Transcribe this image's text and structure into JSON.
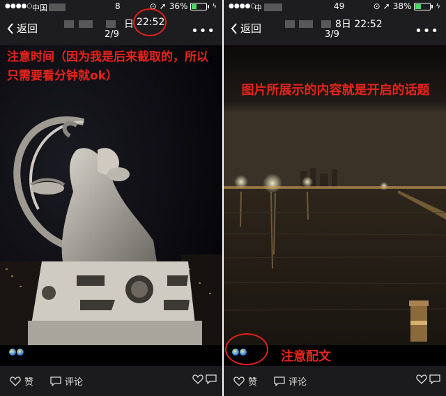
{
  "left": {
    "status": {
      "signal": "●●●●○",
      "carrier": "中国",
      "time_fragment": "8",
      "battery_percent": "36%",
      "battery_level": 0.36
    },
    "nav": {
      "back_label": "返回",
      "date_fragment": "日",
      "time": "22:52",
      "counter": "2/9",
      "more": "•••"
    },
    "annotation": "注意时间（因为我是后来截取的，所以只需要看分钟就ok）",
    "actions": {
      "like": "赞",
      "comment": "评论"
    }
  },
  "right": {
    "status": {
      "signal": "●●●●○",
      "carrier": "中",
      "time_fragment": "49",
      "battery_percent": "38%",
      "battery_level": 0.38
    },
    "nav": {
      "back_label": "返回",
      "date_time": "8日 22:52",
      "counter": "3/9",
      "more": "•••"
    },
    "annotation_top": "图片所展示的内容就是开启的话题",
    "annotation_bottom": "注意配文",
    "actions": {
      "like": "赞",
      "comment": "评论"
    }
  },
  "colors": {
    "annotation": "#e8231c",
    "bar": "#1d1d1f",
    "battery": "#4cd964"
  }
}
